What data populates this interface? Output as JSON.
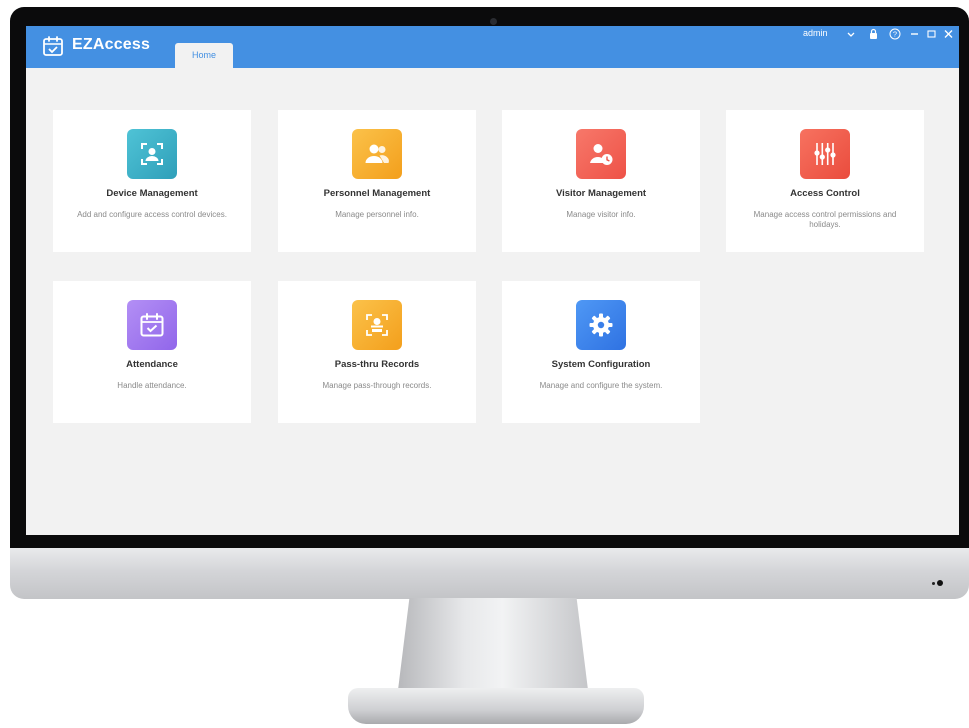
{
  "app": {
    "name": "EZAccess"
  },
  "tabs": [
    {
      "label": "Home"
    }
  ],
  "user": {
    "name": "admin"
  },
  "window_controls": [
    "chevron-down-icon",
    "lock-icon",
    "help-icon",
    "minimize-icon",
    "maximize-icon",
    "close-icon"
  ],
  "cards": [
    {
      "title": "Device Management",
      "desc": "Add and configure access control devices.",
      "icon": "device-icon",
      "color": "#3fb8c9"
    },
    {
      "title": "Personnel Management",
      "desc": "Manage personnel info.",
      "icon": "personnel-icon",
      "color": "#f7b02f"
    },
    {
      "title": "Visitor Management",
      "desc": "Manage visitor info.",
      "icon": "visitor-icon",
      "color": "#f5675a"
    },
    {
      "title": "Access Control",
      "desc": "Manage access control permissions and holidays.",
      "icon": "sliders-icon",
      "color": "#f2614f"
    },
    {
      "title": "Attendance",
      "desc": "Handle attendance.",
      "icon": "calendar-check-icon",
      "color": "#a57ff0"
    },
    {
      "title": "Pass-thru Records",
      "desc": "Manage pass-through records.",
      "icon": "face-scan-icon",
      "color": "#f7b02f"
    },
    {
      "title": "System Configuration",
      "desc": "Manage and configure the system.",
      "icon": "gear-icon",
      "color": "#3e86ee"
    }
  ]
}
